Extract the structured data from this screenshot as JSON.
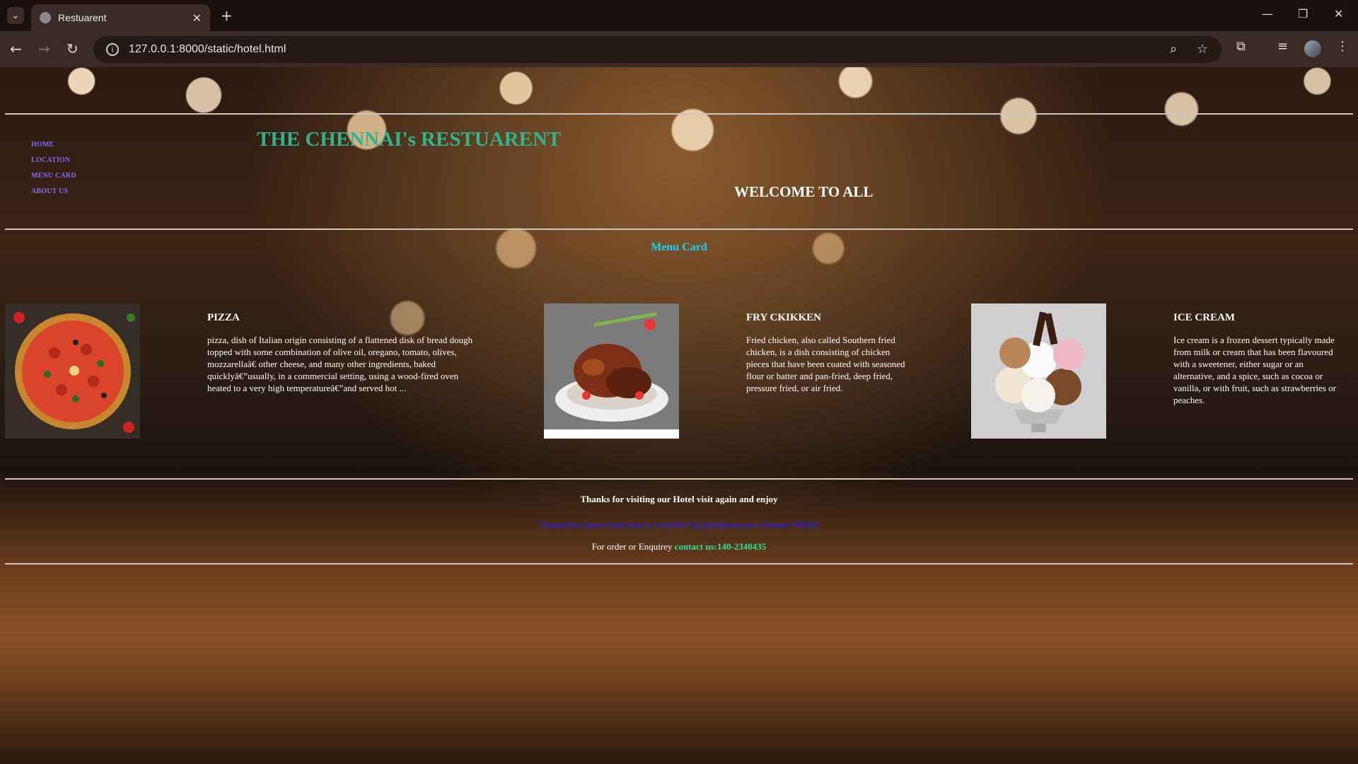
{
  "browser": {
    "tab_title": "Restuarent",
    "url": "127.0.0.1:8000/static/hotel.html"
  },
  "nav": {
    "items": [
      "HOME",
      "LOCATION",
      "MENU CARD",
      "ABOUT US"
    ]
  },
  "header": {
    "title": "THE CHENNAI's RESTUARENT",
    "welcome": "WELCOME TO ALL"
  },
  "menu": {
    "heading": "Menu Card",
    "items": [
      {
        "name": "PIZZA",
        "description": "pizza, dish of Italian origin consisting of a flattened disk of bread dough topped with some combination of olive oil, oregano, tomato, olives, mozzarellaâ€ other cheese, and many other ingredients, baked quicklyâ€”usually, in a commercial setting, using a wood-fired oven heated to a very high temperatureâ€”and served hot ..."
      },
      {
        "name": "FRY CKIKKEN",
        "description": "Fried chicken, also called Southern fried chicken, is a dish consisting of chicken pieces that have been coated with seasoned flour or batter and pan-fried, deep fried, pressure fried, or air fried."
      },
      {
        "name": "ICE CREAM",
        "description": "Ice cream is a frozen dessert typically made from milk or cream that has been flavoured with a sweetener, either sugar or an alternative, and a spice, such as cocoa or vanilla, or with fruit, such as strawberries or peaches."
      }
    ]
  },
  "footer": {
    "thanks": "Thanks for visiting our Hotel visit again and enjoy",
    "address": "Thandalam Queen land near to saveetha clg thandalam post chennai 100003",
    "enquiry_prefix": "For order or Enquirey",
    "contact": "contact us:140-2340435"
  }
}
